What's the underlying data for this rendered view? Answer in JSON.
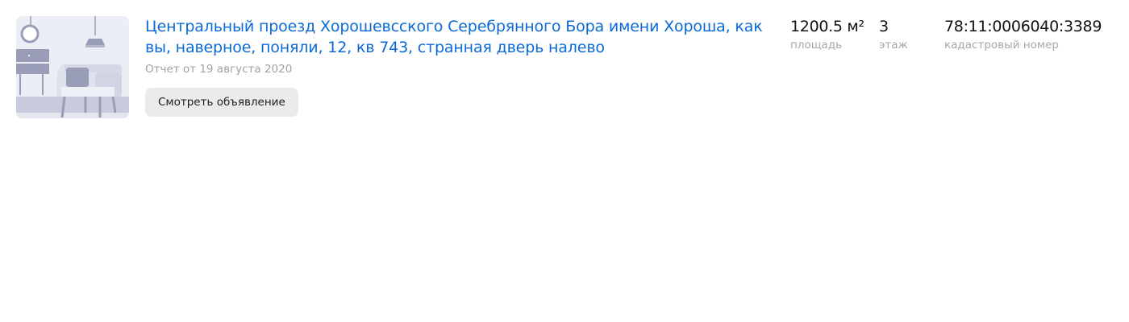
{
  "listing": {
    "title": "Центральный проезд Хорошевсского Серебрянного Бора имени Хороша, как вы, наверное, поняли, 12, кв 743, странная дверь налево",
    "report_date": "Отчет от 19 августа 2020",
    "view_button_label": "Смотреть объявление",
    "thumbnail_icon": "interior-illustration-icon"
  },
  "stats": {
    "area": {
      "value": "1200.5 м²",
      "label": "площадь"
    },
    "floor": {
      "value": "3",
      "label": "этаж"
    },
    "cadastral": {
      "value": "78:11:0006040:3389",
      "label": "кадастровый номер"
    }
  },
  "colors": {
    "link": "#0a6ad8",
    "muted": "#a4a8ae",
    "button_bg": "#ebebeb",
    "illustration_bg": "#eceef6",
    "illustration_dark": "#9a9db8",
    "illustration_light": "#c9cbdc"
  }
}
